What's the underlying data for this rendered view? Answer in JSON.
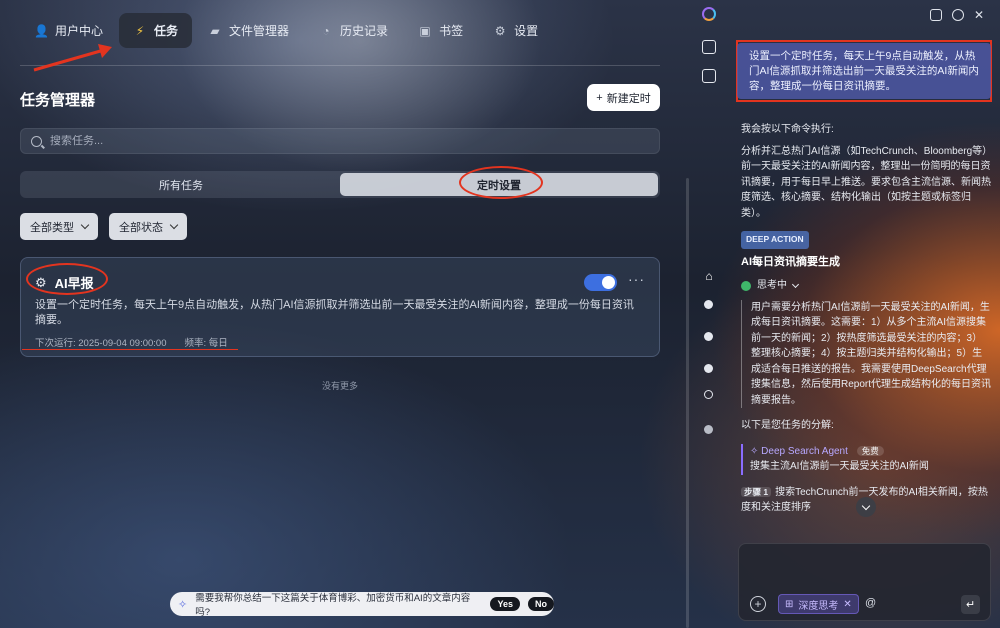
{
  "nav": {
    "items": [
      {
        "label": "用户中心",
        "icon": "user-icon",
        "active": false
      },
      {
        "label": "任务",
        "icon": "lightning-icon",
        "active": true
      },
      {
        "label": "文件管理器",
        "icon": "folder-icon",
        "active": false
      },
      {
        "label": "历史记录",
        "icon": "clock-icon",
        "active": false
      },
      {
        "label": "书签",
        "icon": "bookmark-icon",
        "active": false
      },
      {
        "label": "设置",
        "icon": "gear-icon",
        "active": false
      }
    ]
  },
  "tasks": {
    "title": "任务管理器",
    "new_button": "新建定时",
    "search_placeholder": "搜索任务...",
    "tabs": [
      {
        "label": "所有任务",
        "active": false
      },
      {
        "label": "定时设置",
        "active": true
      }
    ],
    "filters": {
      "type": "全部类型",
      "status": "全部状态"
    },
    "items": [
      {
        "title": "AI早报",
        "enabled": true,
        "description": "设置一个定时任务，每天上午9点自动触发，从热门AI信源抓取并筛选出前一天最受关注的AI新闻内容，整理成一份每日资讯摘要。",
        "next_run": "下次运行: 2025-09-04 09:00:00",
        "frequency": "频率: 每日"
      }
    ],
    "no_more": "没有更多"
  },
  "suggestion": {
    "text": "需要我帮你总结一下这篇关于体育博彩、加密货币和AI的文章内容吗?",
    "yes": "Yes",
    "no": "No"
  },
  "chat": {
    "user_message": "设置一个定时任务，每天上午9点自动触发，从热门AI信源抓取并筛选出前一天最受关注的AI新闻内容，整理成一份每日资讯摘要。",
    "intro": "我会按以下命令执行:",
    "command": "分析并汇总热门AI信源（如TechCrunch、Bloomberg等）前一天最受关注的AI新闻内容，整理出一份简明的每日资讯摘要，用于每日早上推送。要求包含主流信源、新闻热度筛选、核心摘要、结构化输出（如按主题或标签归类）。",
    "badge": "DEEP ACTION",
    "action_title": "AI每日资讯摘要生成",
    "thinking_label": "思考中",
    "thinking": "用户需要分析热门AI信源前一天最受关注的AI新闻，生成每日资讯摘要。这需要：1）从多个主流AI信源搜集前一天的新闻；2）按热度筛选最受关注的内容；3）整理核心摘要；4）按主题归类并结构化输出；5）生成适合每日推送的报告。我需要使用DeepSearch代理搜集信息，然后使用Report代理生成结构化的每日资讯摘要报告。",
    "breakdown": "以下是您任务的分解:",
    "agent_name": "Deep Search Agent",
    "agent_tag": "免费",
    "agent_desc": "搜集主流AI信源前一天最受关注的AI新闻",
    "step_tag": "步骤 1",
    "step_text": "搜索TechCrunch前一天发布的AI相关新闻，按热度和关注度排序",
    "chip": "深度思考",
    "at": "@"
  },
  "colors": {
    "accent": "#3d6fe0",
    "annotation": "#e3341f",
    "user_bubble": "#505aaa"
  }
}
